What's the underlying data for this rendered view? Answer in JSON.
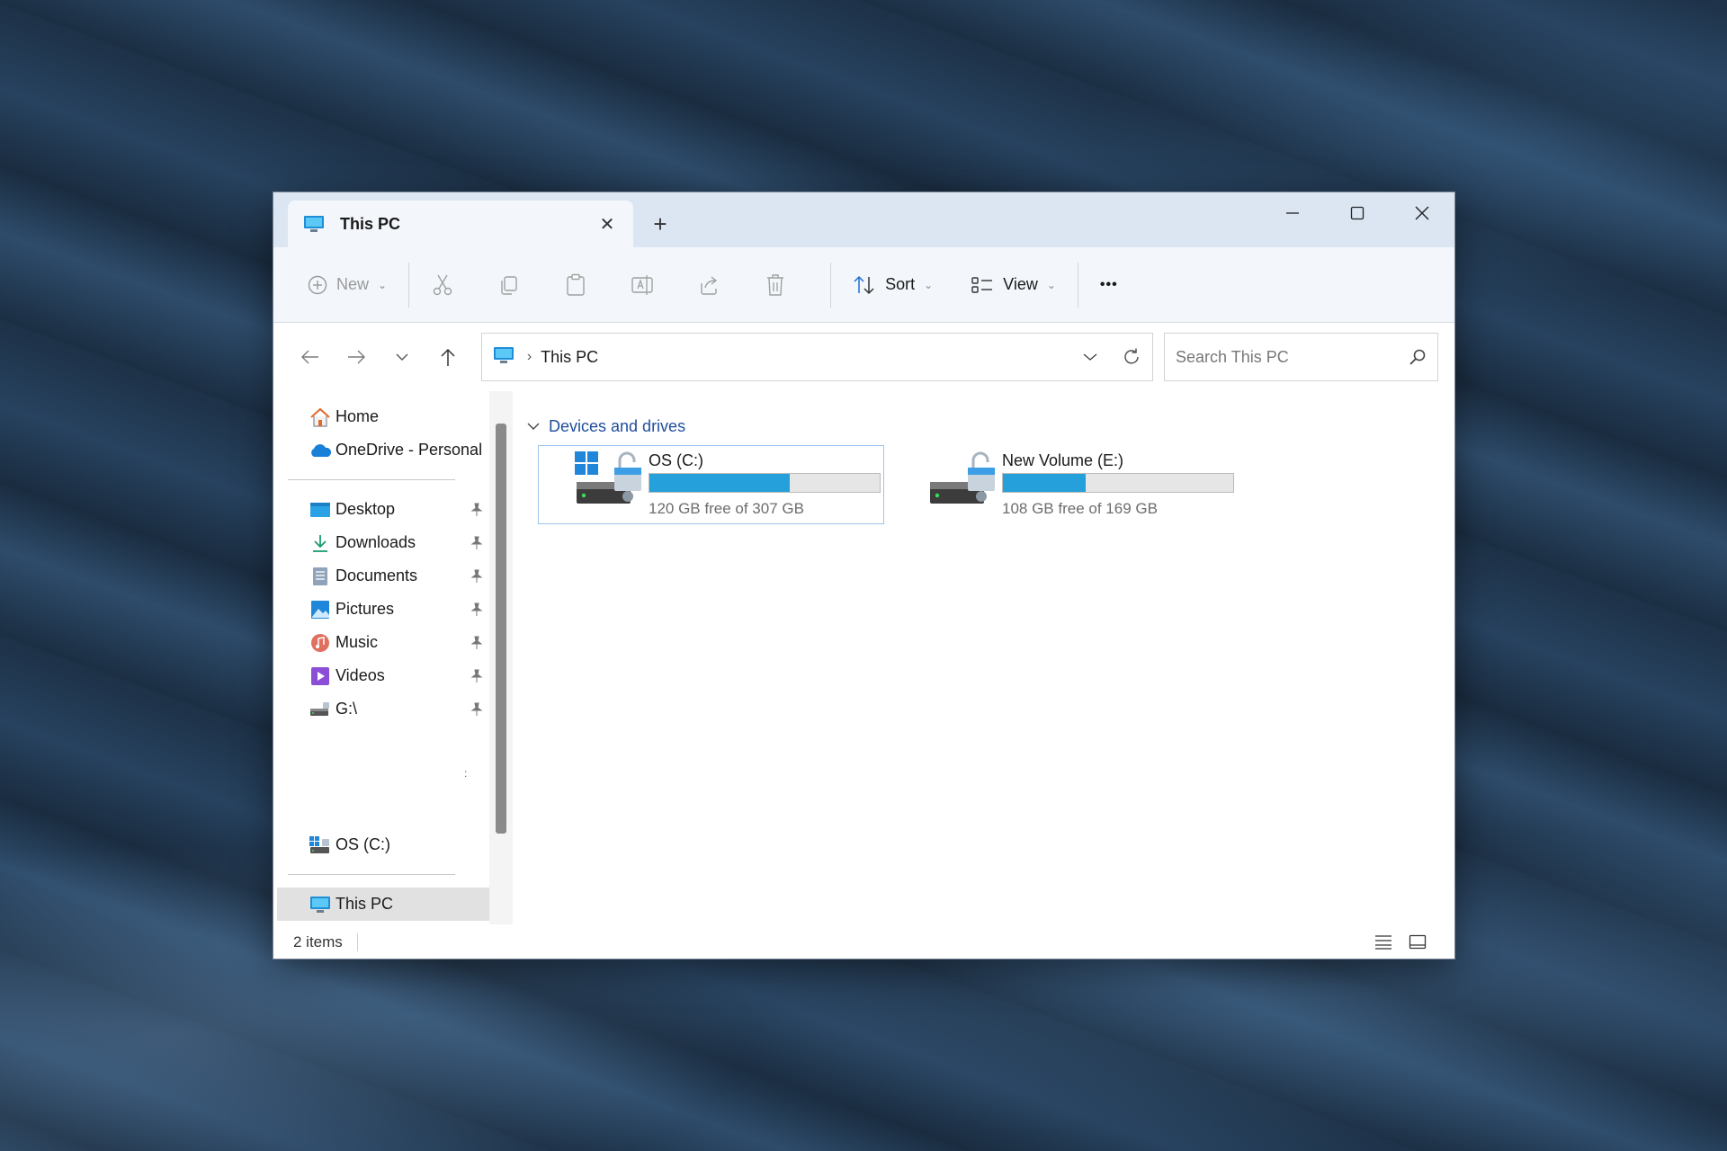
{
  "window": {
    "tab_title": "This PC",
    "new_tab_symbol": "+",
    "tab_close_symbol": "✕",
    "minimize_symbol": "—",
    "maximize_symbol": "☐",
    "close_symbol": "✕"
  },
  "toolbar": {
    "new_label": "New",
    "sort_label": "Sort",
    "view_label": "View",
    "more_symbol": "•••",
    "chevron": "⌄"
  },
  "address": {
    "crumb": "This PC",
    "separator": "›",
    "search_placeholder": "Search This PC"
  },
  "sidebar": {
    "top_items": [
      {
        "label": "Home",
        "icon": "home-icon"
      },
      {
        "label": "OneDrive - Personal",
        "icon": "onedrive-icon"
      }
    ],
    "pinned": [
      {
        "label": "Desktop",
        "icon": "desktop-folder-icon"
      },
      {
        "label": "Downloads",
        "icon": "downloads-folder-icon"
      },
      {
        "label": "Documents",
        "icon": "documents-folder-icon"
      },
      {
        "label": "Pictures",
        "icon": "pictures-folder-icon"
      },
      {
        "label": "Music",
        "icon": "music-folder-icon"
      },
      {
        "label": "Videos",
        "icon": "videos-folder-icon"
      },
      {
        "label": "G:\\",
        "icon": "drive-icon"
      }
    ],
    "drive_item": {
      "label": "OS (C:)",
      "icon": "os-drive-icon"
    },
    "this_pc": {
      "label": "This PC",
      "icon": "computer-icon"
    },
    "dots": ":"
  },
  "main": {
    "group_title": "Devices and drives",
    "drives": [
      {
        "name": "OS (C:)",
        "free_text": "120 GB free of 307 GB",
        "used_fraction": 0.61,
        "icon": "os-drive-lock-icon"
      },
      {
        "name": "New Volume (E:)",
        "free_text": "108 GB free of 169 GB",
        "used_fraction": 0.36,
        "icon": "volume-drive-lock-icon"
      }
    ]
  },
  "status": {
    "item_count": "2 items"
  },
  "colors": {
    "accent": "#26a0da",
    "group_header": "#1f4e9c",
    "titlebar": "#dbe6f2"
  }
}
